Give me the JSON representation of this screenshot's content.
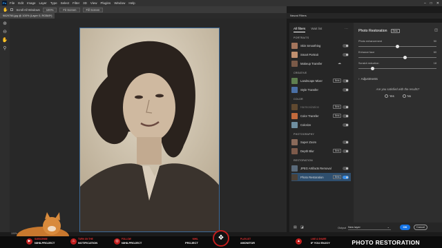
{
  "menubar": {
    "items": [
      "File",
      "Edit",
      "Image",
      "Layer",
      "Type",
      "Select",
      "Filter",
      "3D",
      "View",
      "Plugins",
      "Window",
      "Help"
    ]
  },
  "options": {
    "scroll_all": "Scroll All Windows",
    "zoom": "100%",
    "fit_screen": "Fit Screen",
    "fill_screen": "Fill Screen"
  },
  "document": {
    "tab": "9829756.jpg @ 100% (Layer 0, RGB/8*)"
  },
  "status": {
    "zoom": "100%"
  },
  "neural_filters": {
    "title": "Neural Filters",
    "tabs": {
      "all": "All filters",
      "wait": "Wait list"
    },
    "categories": [
      {
        "name": "PORTRAITS",
        "filters": [
          {
            "label": "Skin Smoothing"
          },
          {
            "label": "Smart Portrait"
          },
          {
            "label": "Makeup Transfer"
          }
        ]
      },
      {
        "name": "CREATIVE",
        "filters": [
          {
            "label": "Landscape Mixer",
            "badge": "Beta"
          },
          {
            "label": "Style Transfer"
          }
        ]
      },
      {
        "name": "COLOR",
        "filters": [
          {
            "label": "Harmonization",
            "badge": "Beta"
          },
          {
            "label": "Color Transfer",
            "badge": "Beta"
          },
          {
            "label": "Colorize"
          }
        ]
      },
      {
        "name": "PHOTOGRAPHY",
        "filters": [
          {
            "label": "Super Zoom"
          },
          {
            "label": "Depth Blur",
            "badge": "Beta"
          }
        ]
      },
      {
        "name": "RESTORATION",
        "filters": [
          {
            "label": "JPEG Artifacts Removal"
          },
          {
            "label": "Photo Restoration",
            "badge": "Beta"
          }
        ]
      }
    ],
    "detail": {
      "title": "Photo Restoration",
      "badge": "Beta",
      "sliders": [
        {
          "label": "Photo enhancement",
          "value": "50",
          "level": 0.5
        },
        {
          "label": "Enhance face",
          "value": "60",
          "level": 0.6
        },
        {
          "label": "Scratch reduction",
          "value": "18",
          "level": 0.18
        }
      ],
      "adjustments": "Adjustments",
      "question": "Are you satisfied with the results?",
      "yes": "Yes",
      "no": "No"
    },
    "footer": {
      "output_label": "Output",
      "output_value": "New layer",
      "ok": "OK",
      "cancel": "Cancel"
    }
  },
  "streambar": {
    "items": [
      {
        "small": "SUBSCRIBE",
        "text": "NIHILPROJECT"
      },
      {
        "small": "TURN ON THE",
        "text": "NOTIFICATION"
      },
      {
        "small": "FOLLOW",
        "text": "NIHILPROJECT"
      },
      {
        "small": "NIHIL",
        "text": "PROJECT"
      },
      {
        "small": "PLAYLIST",
        "text": "#MONITOR"
      },
      {
        "small": "LIKE & SHARE",
        "text": "IF YOU ENJOY"
      }
    ],
    "title": "PHOTO RESTORATION"
  }
}
